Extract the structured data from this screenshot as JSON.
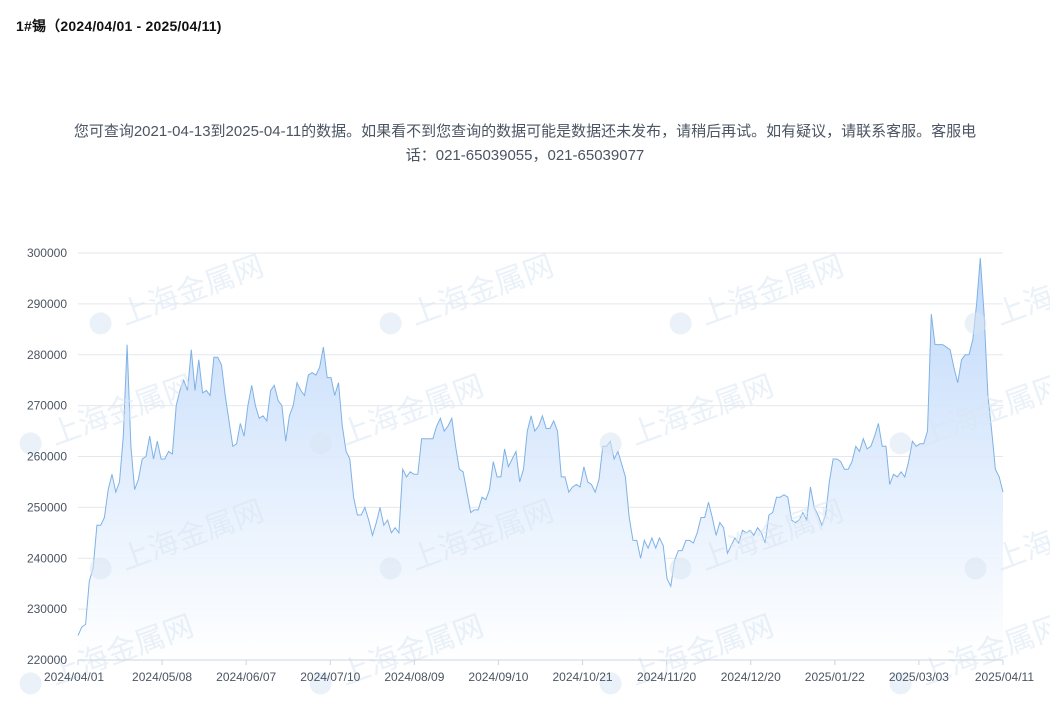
{
  "header": {
    "title": "1#锡（2024/04/01 - 2025/04/11)"
  },
  "notice": {
    "line1": "您可查询2021-04-13到2025-04-11的数据。如果看不到您查询的数据可能是数据还未发布，请稍后再试。如有疑议，请联系客服。客服电",
    "line2": "话：021-65039055，021-65039077"
  },
  "watermark": {
    "text": "上海金属网"
  },
  "colors": {
    "line": "#7fb2e5",
    "fill_top": "#bcd7fb",
    "fill_bottom": "#ffffff",
    "grid": "#e5e7eb",
    "axis": "#cbd5e1"
  },
  "chart_data": {
    "type": "area",
    "title": "",
    "xlabel": "",
    "ylabel": "",
    "ylim": [
      220000,
      300000
    ],
    "yticks": [
      220000,
      230000,
      240000,
      250000,
      260000,
      270000,
      280000,
      290000,
      300000
    ],
    "xticks": [
      "2024/04/01",
      "2024/05/08",
      "2024/06/07",
      "2024/07/10",
      "2024/08/09",
      "2024/09/10",
      "2024/10/21",
      "2024/11/20",
      "2024/12/20",
      "2025/01/22",
      "2025/03/03",
      "2025/04/11"
    ],
    "grid": true,
    "legend": "none",
    "series": [
      {
        "values": [
          224800,
          226500,
          227000,
          235500,
          238000,
          246500,
          246500,
          248000,
          253500,
          256500,
          253000,
          255000,
          264000,
          282000,
          262000,
          253500,
          255500,
          259500,
          260000,
          264000,
          259500,
          263000,
          259500,
          259500,
          261000,
          260500,
          270000,
          273000,
          275000,
          273000,
          281000,
          273000,
          279000,
          272500,
          273000,
          272000,
          279500,
          279500,
          278000,
          272000,
          267000,
          262000,
          262500,
          266500,
          264000,
          270000,
          274000,
          270000,
          267500,
          268000,
          267000,
          273000,
          274000,
          271000,
          270000,
          263000,
          268000,
          270000,
          274500,
          273000,
          272000,
          276000,
          276500,
          276000,
          277500,
          281500,
          275500,
          275500,
          272000,
          274500,
          266000,
          261000,
          259500,
          252000,
          248500,
          248500,
          250000,
          247500,
          244500,
          247000,
          250000,
          246500,
          247500,
          245000,
          246000,
          245000,
          257500,
          256000,
          257000,
          256500,
          256500,
          263500,
          263500,
          263500,
          263500,
          266000,
          267500,
          265000,
          266000,
          267500,
          262000,
          257500,
          257000,
          253000,
          249000,
          249500,
          249500,
          252000,
          251500,
          253500,
          259000,
          256000,
          256000,
          261500,
          258000,
          259500,
          261000,
          255000,
          257500,
          265000,
          268000,
          265000,
          266000,
          268000,
          265500,
          265500,
          267000,
          265000,
          256000,
          256000,
          253000,
          254000,
          254500,
          254000,
          258000,
          255000,
          254500,
          253000,
          255500,
          262000,
          262000,
          263000,
          259500,
          261000,
          258500,
          256000,
          248000,
          243500,
          243500,
          240000,
          243500,
          242000,
          244000,
          242000,
          244000,
          242500,
          236000,
          234500,
          239500,
          241500,
          241500,
          243500,
          243500,
          243000,
          245000,
          248000,
          248000,
          251000,
          248000,
          244500,
          247000,
          246000,
          241000,
          242500,
          244000,
          243000,
          245500,
          245000,
          245500,
          244500,
          246000,
          245000,
          243000,
          248500,
          249000,
          252000,
          252000,
          252500,
          252000,
          247500,
          247000,
          247500,
          249000,
          247500,
          254000,
          250000,
          248500,
          246500,
          248500,
          255000,
          259500,
          259500,
          259000,
          257500,
          257500,
          259000,
          262000,
          261000,
          263500,
          261500,
          262000,
          264000,
          266500,
          262000,
          262000,
          254500,
          256500,
          256000,
          257000,
          256000,
          259000,
          263000,
          262000,
          262500,
          262500,
          265000,
          288000,
          282000,
          282000,
          282000,
          281500,
          281000,
          277500,
          274500,
          279000,
          280000,
          280000,
          283000,
          290000,
          299000,
          288000,
          272000,
          265000,
          257500,
          256000,
          253000
        ]
      }
    ]
  }
}
